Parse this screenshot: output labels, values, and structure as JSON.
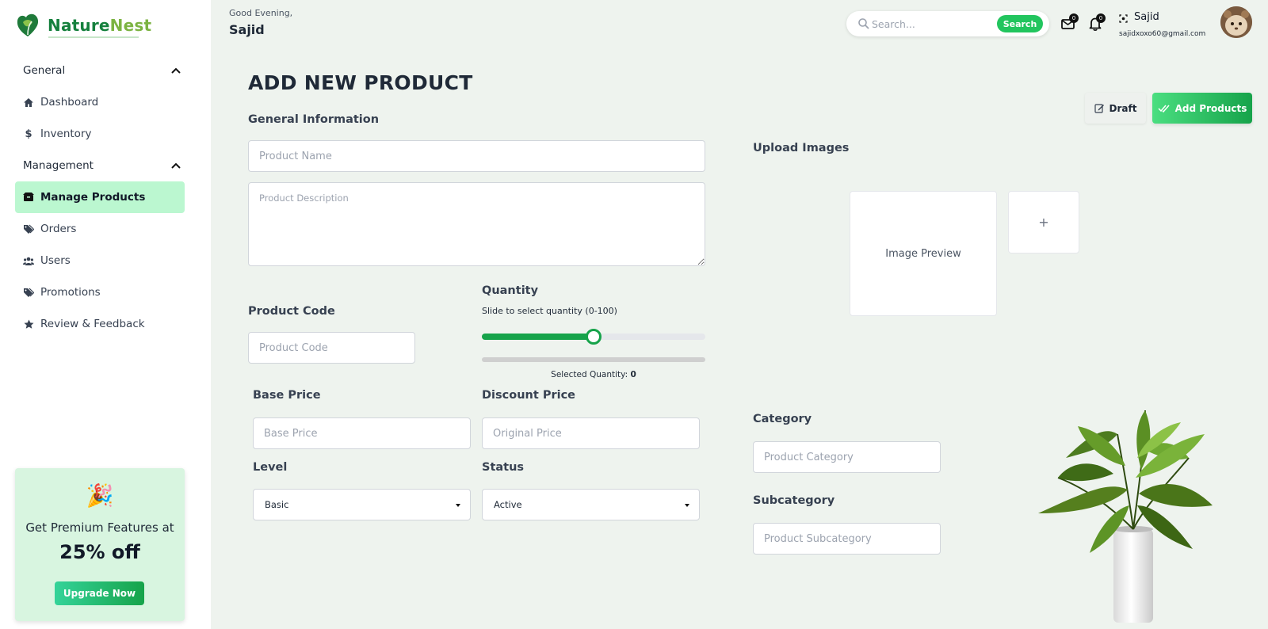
{
  "brand": {
    "part1": "Nature",
    "part2": "Nest"
  },
  "sidebar": {
    "sections": [
      {
        "title": "General",
        "items": [
          {
            "label": "Dashboard",
            "icon": "home-icon"
          },
          {
            "label": "Inventory",
            "icon": "dollar-icon"
          }
        ]
      },
      {
        "title": "Management",
        "items": [
          {
            "label": "Manage Products",
            "icon": "box-icon",
            "active": true
          },
          {
            "label": "Orders",
            "icon": "tags-icon"
          },
          {
            "label": "Users",
            "icon": "users-icon"
          },
          {
            "label": "Promotions",
            "icon": "tags-icon"
          },
          {
            "label": "Review & Feedback",
            "icon": "star-icon"
          }
        ]
      }
    ],
    "promo": {
      "emoji": "🎉",
      "text": "Get Premium Features at",
      "highlight": "25% off",
      "button": "Upgrade Now"
    }
  },
  "header": {
    "greeting": "Good Evening,",
    "name": "Sajid",
    "search": {
      "placeholder": "Search...",
      "button": "Search"
    },
    "mail_count": "0",
    "notif_count": "0",
    "user": {
      "name": "Sajid",
      "email": "sajidxoxo60@gmail.com"
    }
  },
  "main": {
    "title": "ADD NEW PRODUCT",
    "draft_label": "Draft",
    "add_label": "Add Products",
    "general_info": "General Information",
    "product_name_ph": "Product Name",
    "product_desc_ph": "Product Description",
    "product_code_label": "Product Code",
    "product_code_ph": "Product Code",
    "quantity": {
      "label": "Quantity",
      "hint": "Slide to select quantity (0-100)",
      "slider_fraction": 0.5,
      "selected_label": "Selected Quantity:",
      "selected_value": "0"
    },
    "base_price_label": "Base Price",
    "base_price_ph": "Base Price",
    "discount_label": "Discount Price",
    "discount_ph": "Original Price",
    "level_label": "Level",
    "level_value": "Basic",
    "status_label": "Status",
    "status_value": "Active",
    "upload_label": "Upload Images",
    "preview_text": "Image Preview",
    "add_image": "+",
    "category_label": "Category",
    "category_ph": "Product Category",
    "subcategory_label": "Subcategory",
    "subcategory_ph": "Product Subcategory"
  },
  "colors": {
    "accent": "#16a34a",
    "active_nav": "#bbf7d0",
    "background": "#eef3ee"
  }
}
